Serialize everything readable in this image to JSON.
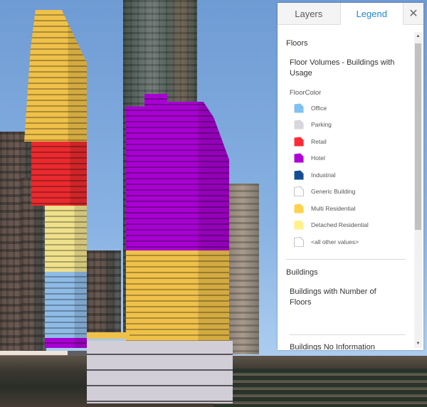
{
  "panel": {
    "tabs": [
      {
        "label": "Layers",
        "active": false
      },
      {
        "label": "Legend",
        "active": true
      }
    ],
    "close_icon": "close-icon",
    "legend": {
      "service_1": {
        "title": "Floors",
        "layer_title": "Floor Volumes - Buildings with Usage",
        "field_title": "FloorColor",
        "items": [
          {
            "label": "Office",
            "color": "#7fc1ef"
          },
          {
            "label": "Parking",
            "color": "#d6d6dc"
          },
          {
            "label": "Retail",
            "color": "#ff2a36"
          },
          {
            "label": "Hotel",
            "color": "#b000d8"
          },
          {
            "label": "Industrial",
            "color": "#154f92"
          },
          {
            "label": "Generic Building",
            "color": "#ffffff"
          },
          {
            "label": "Multi Residential",
            "color": "#ffd24d"
          },
          {
            "label": "Detached Residential",
            "color": "#fff18a"
          },
          {
            "label": "<all other values>",
            "color": "#ffffff"
          }
        ]
      },
      "service_2": {
        "title": "Buildings",
        "layer_1_title": "Buildings with Number of Floors",
        "layer_2_title": "Buildings No Information"
      }
    }
  },
  "scene": {
    "floor_colors": {
      "office": "#8fbbe6",
      "parking": "#d2ced8",
      "retail": "#ea2a2e",
      "hotel": "#a800d2",
      "multi_residential": "#efc14a",
      "detached_residential": "#efe08c"
    }
  }
}
